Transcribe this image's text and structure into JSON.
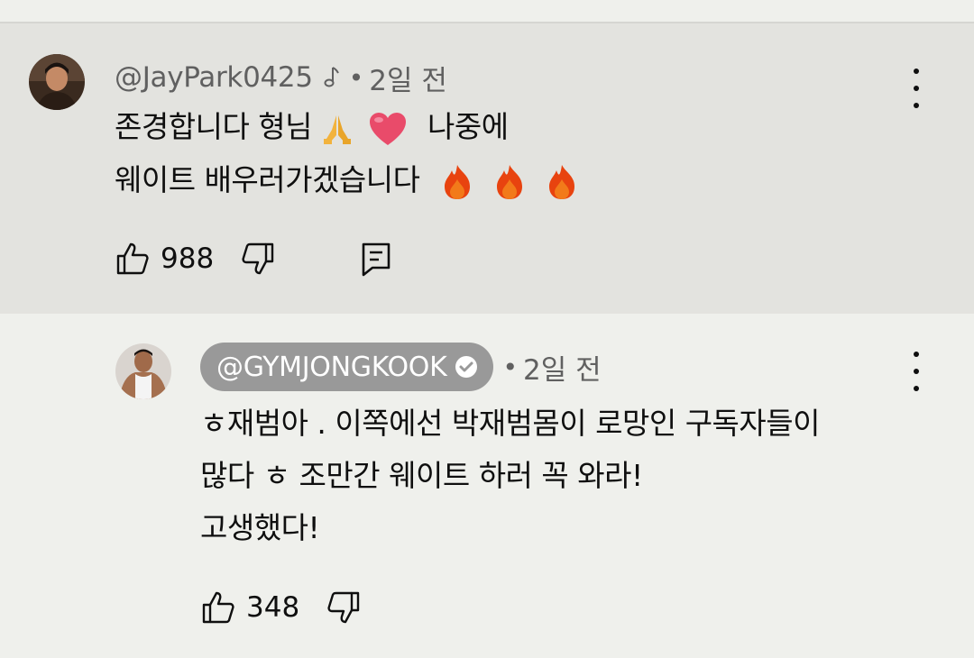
{
  "comment": {
    "author": "@JayPark0425",
    "time": "2일 전",
    "text_line1": "존경합니다 형님",
    "text_line1_after": "나중에",
    "text_line2": "웨이트 배우러가겠습니다",
    "likes": "988",
    "icons": [
      "music-note-icon",
      "folded-hands-emoji",
      "heart-emoji",
      "fire-emoji",
      "thumb-up-icon",
      "thumb-down-icon",
      "reply-icon",
      "more-vert-icon"
    ]
  },
  "reply": {
    "author": "@GYMJONGKOOK",
    "time": "2일 전",
    "text_line1": "ㅎ재범아 . 이쪽에선 박재범몸이 로망인 구독자들이",
    "text_line2": "많다 ㅎ 조만간 웨이트 하러 꼭 와라!",
    "text_line3": "고생했다!",
    "likes": "348",
    "icons": [
      "verified-check-icon",
      "thumb-up-icon",
      "thumb-down-icon",
      "more-vert-icon"
    ]
  },
  "colors": {
    "highlight_bg": "#e3e3df",
    "page_bg": "#eff0ec",
    "channel_pill": "#999999",
    "fire": "#e8430f",
    "heart": "#e94b6a"
  }
}
